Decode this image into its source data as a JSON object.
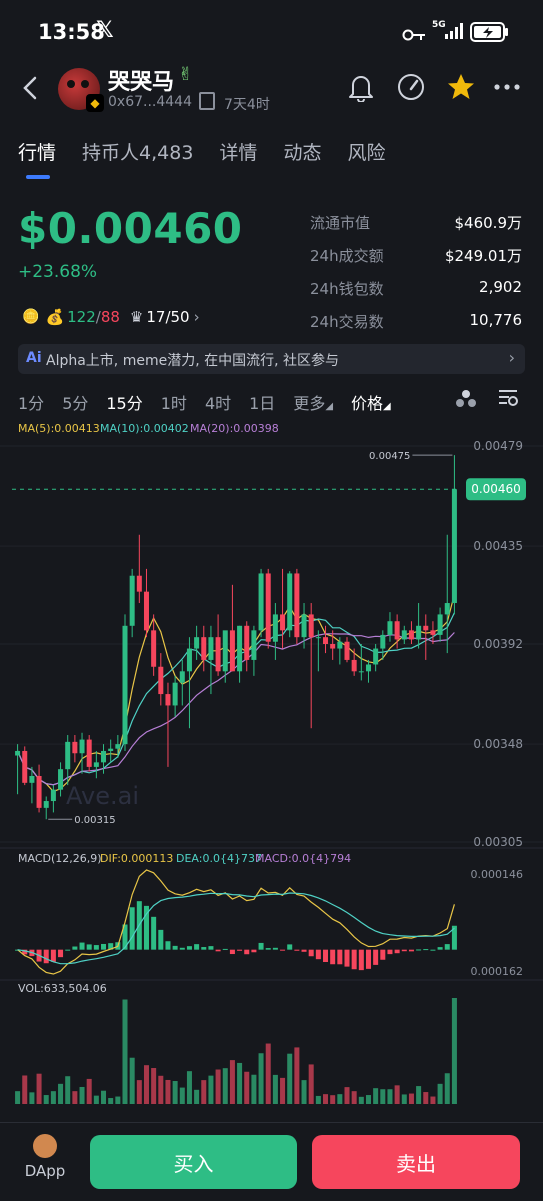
{
  "status_bar": {
    "time": "13:58",
    "network": "5G",
    "x_app_icon": "x-logo-icon"
  },
  "header": {
    "name": "哭哭马",
    "address": "0x67...4444",
    "age": "7天4时"
  },
  "tabs": [
    {
      "label": "行情",
      "active": true
    },
    {
      "label": "持币人4,483",
      "active": false
    },
    {
      "label": "详情",
      "active": false
    },
    {
      "label": "动态",
      "active": false
    },
    {
      "label": "风险",
      "active": false
    }
  ],
  "price": {
    "value": "$0.00460",
    "change": "+23.68%"
  },
  "holders": {
    "buy_sell_green": "122",
    "buy_sell_red": "88",
    "rank": "17/50"
  },
  "stats": [
    {
      "label": "流通市值",
      "value": "$460.9万"
    },
    {
      "label": "24h成交额",
      "value": "$249.01万"
    },
    {
      "label": "24h钱包数",
      "value": "2,902"
    },
    {
      "label": "24h交易数",
      "value": "10,776"
    }
  ],
  "ai_banner": {
    "icon_text": "Ai",
    "text": "Alpha上市, meme潜力, 在中国流行, 社区参与"
  },
  "intervals": [
    {
      "label": "1分",
      "active": false
    },
    {
      "label": "5分",
      "active": false
    },
    {
      "label": "15分",
      "active": true
    },
    {
      "label": "1时",
      "active": false
    },
    {
      "label": "4时",
      "active": false
    },
    {
      "label": "1日",
      "active": false
    },
    {
      "label": "更多",
      "active": false
    },
    {
      "label": "价格",
      "active": false
    }
  ],
  "colors": {
    "up": "#2ebd85",
    "down": "#f6465d",
    "ma5": "#e8c547",
    "ma10": "#4fd1c5",
    "ma20": "#b77fd6",
    "accent": "#3d7bfd"
  },
  "chart_data": {
    "type": "candlestick",
    "ma_legend": {
      "ma5": "MA(5):0.00413",
      "ma10": "MA(10):0.00402",
      "ma20": "MA(20):0.00398"
    },
    "y_ticks": [
      "0.00479",
      "0.00435",
      "0.00392",
      "0.00348",
      "0.00305"
    ],
    "y_range": [
      0.00305,
      0.00479
    ],
    "current_price": "0.00460",
    "max_label": "0.00475",
    "min_label": "0.00315",
    "watermark": "Ave.ai",
    "candles": [
      [
        0.00343,
        0.00348,
        0.00326,
        0.00345
      ],
      [
        0.00345,
        0.00347,
        0.0033,
        0.00331
      ],
      [
        0.00331,
        0.00338,
        0.00322,
        0.00334
      ],
      [
        0.00334,
        0.00339,
        0.00318,
        0.0032
      ],
      [
        0.0032,
        0.00325,
        0.00315,
        0.00323
      ],
      [
        0.00323,
        0.0033,
        0.00318,
        0.00328
      ],
      [
        0.00328,
        0.0034,
        0.00325,
        0.00337
      ],
      [
        0.00337,
        0.00352,
        0.0033,
        0.00349
      ],
      [
        0.00349,
        0.00352,
        0.0034,
        0.00344
      ],
      [
        0.00344,
        0.00353,
        0.00335,
        0.0035
      ],
      [
        0.0035,
        0.00352,
        0.00336,
        0.00338
      ],
      [
        0.00338,
        0.00345,
        0.00333,
        0.0034
      ],
      [
        0.0034,
        0.00348,
        0.00335,
        0.00345
      ],
      [
        0.00345,
        0.0035,
        0.0034,
        0.00346
      ],
      [
        0.00346,
        0.00352,
        0.00342,
        0.00348
      ],
      [
        0.00348,
        0.00405,
        0.00345,
        0.004
      ],
      [
        0.004,
        0.00425,
        0.00395,
        0.00422
      ],
      [
        0.00422,
        0.0044,
        0.0041,
        0.00415
      ],
      [
        0.00415,
        0.00425,
        0.00395,
        0.00398
      ],
      [
        0.00398,
        0.00405,
        0.00378,
        0.00382
      ],
      [
        0.00382,
        0.00388,
        0.00365,
        0.0037
      ],
      [
        0.0037,
        0.00375,
        0.00338,
        0.00365
      ],
      [
        0.00365,
        0.00378,
        0.0036,
        0.00375
      ],
      [
        0.00375,
        0.00385,
        0.00365,
        0.0038
      ],
      [
        0.0038,
        0.00395,
        0.00355,
        0.0039
      ],
      [
        0.0039,
        0.004,
        0.00385,
        0.00395
      ],
      [
        0.00395,
        0.004,
        0.0038,
        0.00385
      ],
      [
        0.00385,
        0.004,
        0.0037,
        0.00395
      ],
      [
        0.00395,
        0.00405,
        0.00378,
        0.0038
      ],
      [
        0.0038,
        0.00395,
        0.00375,
        0.00398
      ],
      [
        0.00398,
        0.00418,
        0.0038,
        0.0038
      ],
      [
        0.0038,
        0.004,
        0.00375,
        0.004
      ],
      [
        0.004,
        0.00402,
        0.0038,
        0.00385
      ],
      [
        0.00385,
        0.004,
        0.00378,
        0.00398
      ],
      [
        0.00398,
        0.00425,
        0.00395,
        0.00423
      ],
      [
        0.00423,
        0.00425,
        0.0039,
        0.00393
      ],
      [
        0.00393,
        0.0041,
        0.00385,
        0.00405
      ],
      [
        0.00405,
        0.00425,
        0.0039,
        0.00398
      ],
      [
        0.00398,
        0.00424,
        0.00395,
        0.00423
      ],
      [
        0.00423,
        0.00425,
        0.00392,
        0.00395
      ],
      [
        0.00395,
        0.0041,
        0.0039,
        0.00405
      ],
      [
        0.00405,
        0.0041,
        0.00355,
        0.00395
      ],
      [
        0.00395,
        0.00398,
        0.0038,
        0.00395
      ],
      [
        0.00395,
        0.004,
        0.00388,
        0.00392
      ],
      [
        0.00392,
        0.00398,
        0.00385,
        0.0039
      ],
      [
        0.0039,
        0.00395,
        0.00383,
        0.00393
      ],
      [
        0.00393,
        0.00395,
        0.00384,
        0.00385
      ],
      [
        0.00385,
        0.0039,
        0.00378,
        0.0038
      ],
      [
        0.0038,
        0.00392,
        0.00376,
        0.0038
      ],
      [
        0.0038,
        0.00385,
        0.00375,
        0.00383
      ],
      [
        0.00383,
        0.00392,
        0.0038,
        0.0039
      ],
      [
        0.0039,
        0.00398,
        0.00385,
        0.00396
      ],
      [
        0.00396,
        0.00406,
        0.00393,
        0.00402
      ],
      [
        0.00402,
        0.00405,
        0.0039,
        0.00394
      ],
      [
        0.00394,
        0.004,
        0.00392,
        0.00398
      ],
      [
        0.00398,
        0.00402,
        0.00392,
        0.00394
      ],
      [
        0.00394,
        0.0041,
        0.0039,
        0.004
      ],
      [
        0.004,
        0.00405,
        0.00385,
        0.00398
      ],
      [
        0.00398,
        0.00402,
        0.00392,
        0.00396
      ],
      [
        0.00396,
        0.00408,
        0.00393,
        0.00405
      ],
      [
        0.00405,
        0.0044,
        0.00388,
        0.0041
      ],
      [
        0.0041,
        0.00475,
        0.00405,
        0.0046
      ]
    ],
    "macd_legend": {
      "macd": "MACD(12,26,9)",
      "dif": "DIF:0.000113",
      "dea": "DEA:0.0{4}737",
      "hist": "MACD:0.0{4}794"
    },
    "macd_ticks": [
      "0.000146",
      "0.000162"
    ],
    "volume_legend": "VOL:633,504.06"
  },
  "buttons": {
    "dapp": "DApp",
    "buy": "买入",
    "sell": "卖出"
  }
}
